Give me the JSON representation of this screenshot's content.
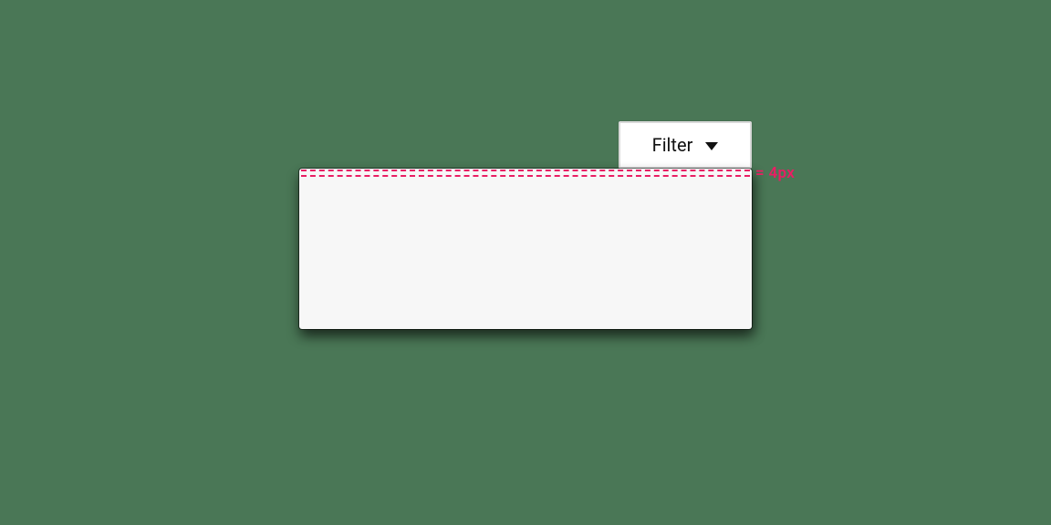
{
  "filter": {
    "label": "Filter"
  },
  "annotation": {
    "spacing_text": "= 4px",
    "color": "#e91e63"
  }
}
